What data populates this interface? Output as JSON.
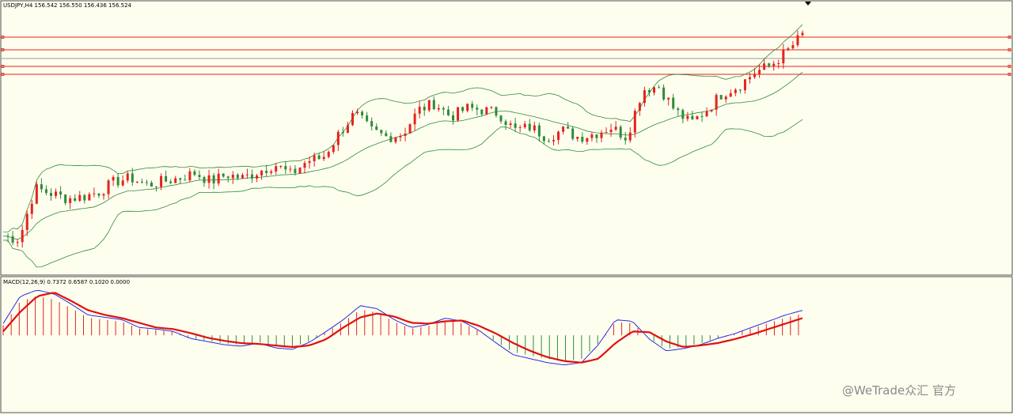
{
  "colors": {
    "background": "#fefeef",
    "up_candle": "#e5231b",
    "down_candle": "#2e8b3a",
    "bollinger": "#2e8b3a",
    "hline": "#e5231b",
    "hline_gray": "#9a9a9a",
    "macd_line": "#2a2ae0",
    "signal_line": "#e01010",
    "hist_pos": "#e5231b",
    "hist_neg": "#2e8b3a"
  },
  "chart_data": [
    {
      "type": "candlestick",
      "label": "USDJPY,H4  156.542 156.550 156.436 156.524",
      "symbol": "USDJPY",
      "timeframe": "H4",
      "quote": {
        "open": 156.542,
        "high": 156.55,
        "low": 156.436,
        "close": 156.524
      },
      "indicators": [
        "Bollinger Bands"
      ],
      "horizontal_lines": [
        {
          "color": "red"
        },
        {
          "color": "red"
        },
        {
          "color": "gray"
        },
        {
          "color": "red"
        },
        {
          "color": "red"
        }
      ],
      "close_path": [
        150.6,
        150.5,
        152.0,
        151.85,
        151.7,
        151.75,
        151.9,
        152.2,
        152.3,
        152.1,
        152.2,
        152.3,
        152.45,
        152.2,
        152.4,
        152.3,
        152.5,
        152.7,
        152.4,
        152.8,
        152.9,
        153.6,
        154.2,
        153.7,
        153.5,
        153.6,
        154.3,
        154.5,
        154.1,
        154.35,
        154.3,
        154.2,
        153.7,
        153.8,
        153.5,
        153.7,
        153.5,
        153.6,
        153.8,
        153.5,
        154.9,
        155.0,
        154.3,
        153.9,
        154.3,
        154.8,
        155.0,
        155.4,
        155.6,
        156.0,
        156.5
      ],
      "trend": "uptrend"
    },
    {
      "type": "line",
      "label": "MACD(12,26,9) 0.7372 0.6587 0.1020 0.0000",
      "params": [
        12,
        26,
        9
      ],
      "values": [
        0.7372,
        0.6587,
        0.102,
        0.0
      ],
      "series": [
        {
          "name": "MACD",
          "values": [
            0.55,
            0.9,
            0.98,
            0.93,
            0.8,
            0.66,
            0.63,
            0.6,
            0.5,
            0.48,
            0.45,
            0.36,
            0.32,
            0.28,
            0.26,
            0.3,
            0.24,
            0.22,
            0.31,
            0.45,
            0.6,
            0.78,
            0.74,
            0.6,
            0.5,
            0.54,
            0.62,
            0.58,
            0.46,
            0.3,
            0.15,
            0.1,
            0.05,
            0.02,
            0.05,
            0.28,
            0.6,
            0.58,
            0.35,
            0.2,
            0.23,
            0.28,
            0.36,
            0.42,
            0.5,
            0.58,
            0.66,
            0.72
          ]
        },
        {
          "name": "Signal",
          "values": [
            0.45,
            0.7,
            0.9,
            0.95,
            0.84,
            0.72,
            0.66,
            0.62,
            0.56,
            0.5,
            0.48,
            0.43,
            0.37,
            0.33,
            0.3,
            0.29,
            0.27,
            0.25,
            0.27,
            0.35,
            0.5,
            0.63,
            0.68,
            0.64,
            0.56,
            0.55,
            0.58,
            0.59,
            0.52,
            0.42,
            0.3,
            0.2,
            0.12,
            0.07,
            0.05,
            0.1,
            0.3,
            0.45,
            0.44,
            0.32,
            0.25,
            0.27,
            0.3,
            0.35,
            0.41,
            0.48,
            0.55,
            0.62
          ]
        }
      ]
    }
  ],
  "watermark": "@WeTrade众汇 官方"
}
